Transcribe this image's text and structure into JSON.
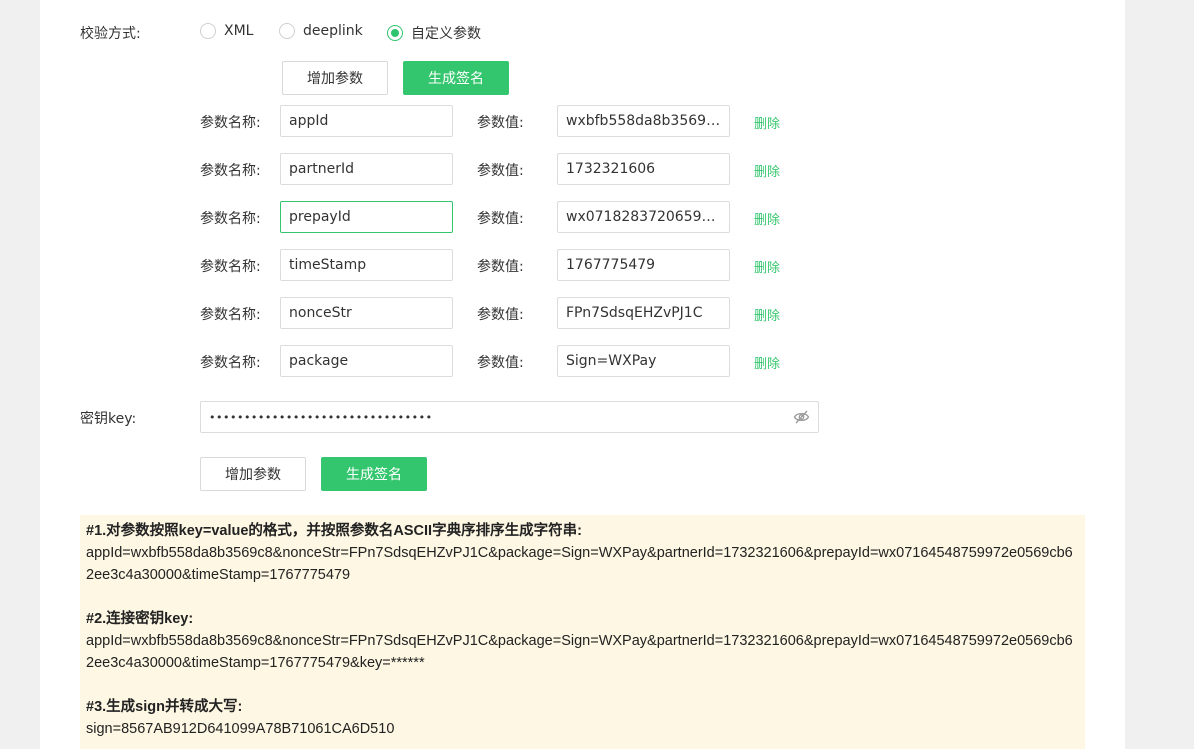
{
  "verify": {
    "label": "校验方式:",
    "options": [
      {
        "label": "XML",
        "checked": false
      },
      {
        "label": "deeplink",
        "checked": false
      },
      {
        "label": "自定义参数",
        "checked": true
      }
    ]
  },
  "top_actions": {
    "add_label": "增加参数",
    "generate_label": "生成签名"
  },
  "params": {
    "name_label": "参数名称:",
    "value_label": "参数值:",
    "delete_label": "删除",
    "rows": [
      {
        "name": "appId",
        "value": "wxbfb558da8b3569c8"
      },
      {
        "name": "partnerId",
        "value": "1732321606"
      },
      {
        "name": "prepayId",
        "value": "wx071828372065961..."
      },
      {
        "name": "timeStamp",
        "value": "1767775479"
      },
      {
        "name": "nonceStr",
        "value": "FPn7SdsqEHZvPJ1C"
      },
      {
        "name": "package",
        "value": "Sign=WXPay"
      }
    ]
  },
  "secret": {
    "label": "密钥key:",
    "value": "••••••••••••••••••••••••••••••••",
    "toggle_icon": "eye-off-icon"
  },
  "bottom_actions": {
    "add_label": "增加参数",
    "generate_label": "生成签名"
  },
  "result": {
    "step1_title": "#1.对参数按照key=value的格式，并按照参数名ASCII字典序排序生成字符串:",
    "step1_text": "appId=wxbfb558da8b3569c8&nonceStr=FPn7SdsqEHZvPJ1C&package=Sign=WXPay&partnerId=1732321606&prepayId=wx07164548759972e0569cb62ee3c4a30000&timeStamp=1767775479",
    "step2_title": "#2.连接密钥key:",
    "step2_text": "appId=wxbfb558da8b3569c8&nonceStr=FPn7SdsqEHZvPJ1C&package=Sign=WXPay&partnerId=1732321606&prepayId=wx07164548759972e0569cb62ee3c4a30000&timeStamp=1767775479&key=******",
    "step3_title": "#3.生成sign并转成大写:",
    "step3_text": "sign=8567AB912D641099A78B71061CA6D510"
  },
  "colors": {
    "accent": "#34c66e",
    "result_bg": "#fdf7e3"
  }
}
